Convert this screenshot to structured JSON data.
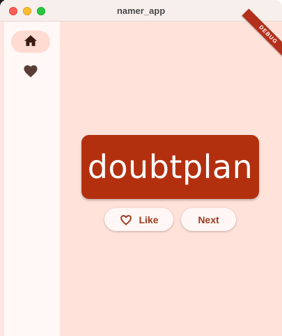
{
  "window": {
    "title": "namer_app"
  },
  "rail": {
    "items": [
      {
        "icon": "home-icon",
        "selected": true
      },
      {
        "icon": "heart-filled-icon",
        "selected": false
      }
    ]
  },
  "main": {
    "debug_banner": "DEBUG",
    "word_pair": "doubtplan",
    "like_label": "Like",
    "next_label": "Next"
  },
  "colors": {
    "card_bg": "#b3300f",
    "content_bg": "#ffe3db",
    "rail_bg": "#fff8f6",
    "rail_selected": "#ffdbd1",
    "button_text": "#9c3a1e",
    "debug_ribbon": "#b3301c"
  }
}
